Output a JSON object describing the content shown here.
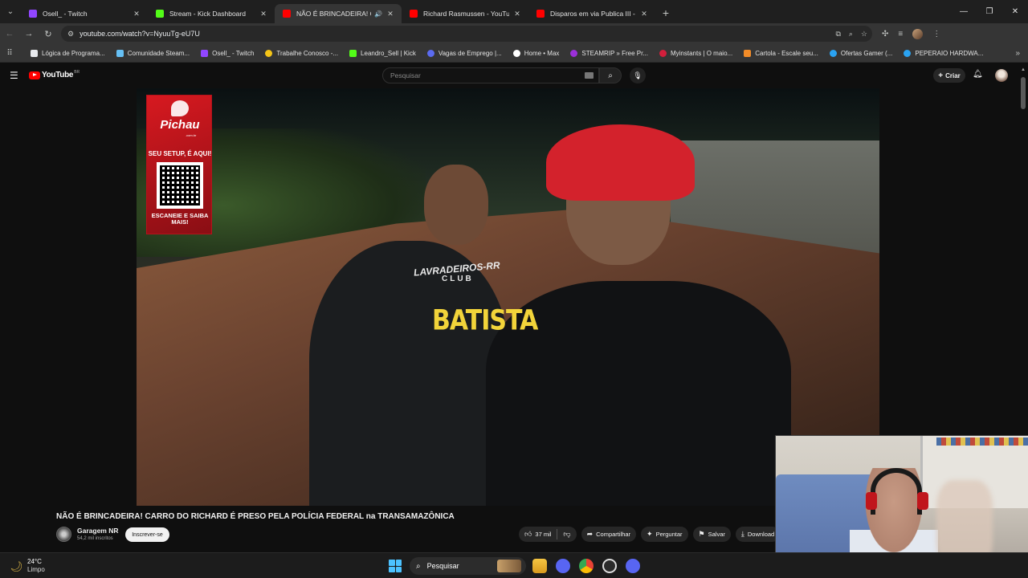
{
  "browser": {
    "tabs": [
      {
        "title": "Osell_ - Twitch",
        "favicon_color": "#9146ff",
        "active": false
      },
      {
        "title": "Stream - Kick Dashboard",
        "favicon_color": "#53fc18",
        "active": false
      },
      {
        "title": "NÃO É BRINCADEIRA! CARRO",
        "favicon_color": "#ff0000",
        "active": true,
        "audio": true
      },
      {
        "title": "Richard Rasmussen - YouTube",
        "favicon_color": "#ff0000",
        "active": false
      },
      {
        "title": "Disparos em via Publica III - Yo",
        "favicon_color": "#ff0000",
        "active": false
      }
    ],
    "address": "youtube.com/watch?v=NyuuTg-eU7U",
    "bookmarks": [
      {
        "label": "Lógica de Programa...",
        "color": "#e8eaed"
      },
      {
        "label": "Comunidade Steam...",
        "color": "#66c0f4"
      },
      {
        "label": "Osell_ - Twitch",
        "color": "#9146ff"
      },
      {
        "label": "Trabalhe Conosco -...",
        "color": "#f5c518"
      },
      {
        "label": "Leandro_Sell | Kick",
        "color": "#53fc18"
      },
      {
        "label": "Vagas de Emprego |...",
        "color": "#5b6bf0"
      },
      {
        "label": "Home • Max",
        "color": "#ffffff"
      },
      {
        "label": "STEAMRIP » Free Pr...",
        "color": "#9b30d9"
      },
      {
        "label": "Myinstants | O maio...",
        "color": "#d21f3c"
      },
      {
        "label": "Cartola - Escale seu...",
        "color": "#f28c28"
      },
      {
        "label": "Ofertas Gamer (...",
        "color": "#2aa3f2"
      },
      {
        "label": "PEPERAIO HARDWA...",
        "color": "#2aa3f2"
      }
    ]
  },
  "youtube": {
    "logo": "YouTube",
    "logo_region": "BR",
    "search_placeholder": "Pesquisar",
    "create_label": "Criar",
    "video_title": "NÃO É BRINCADEIRA! CARRO DO RICHARD É PRESO PELA POLÍCIA FEDERAL na TRANSAMAZÔNICA",
    "channel_name": "Garagem NR",
    "channel_subs": "54,2 mil inscritos",
    "subscribe_label": "Inscrever-se",
    "likes": "37 mil",
    "share_label": "Compartilhar",
    "ask_label": "Perguntar",
    "save_label": "Salvar",
    "download_label": "Download"
  },
  "ad": {
    "brand": "Pichau",
    "domain": ".com.br",
    "slogan": "SEU SETUP, É AQUI!",
    "cta": "ESCANEIE E SAIBA MAIS!"
  },
  "video_overlay": {
    "shirt_club": "LAVRADEIROS-RR",
    "shirt_club2": "CLUB",
    "shirt_name": "BATISTA"
  },
  "taskbar": {
    "temperature": "24°C",
    "condition": "Limpo",
    "search_label": "Pesquisar"
  }
}
